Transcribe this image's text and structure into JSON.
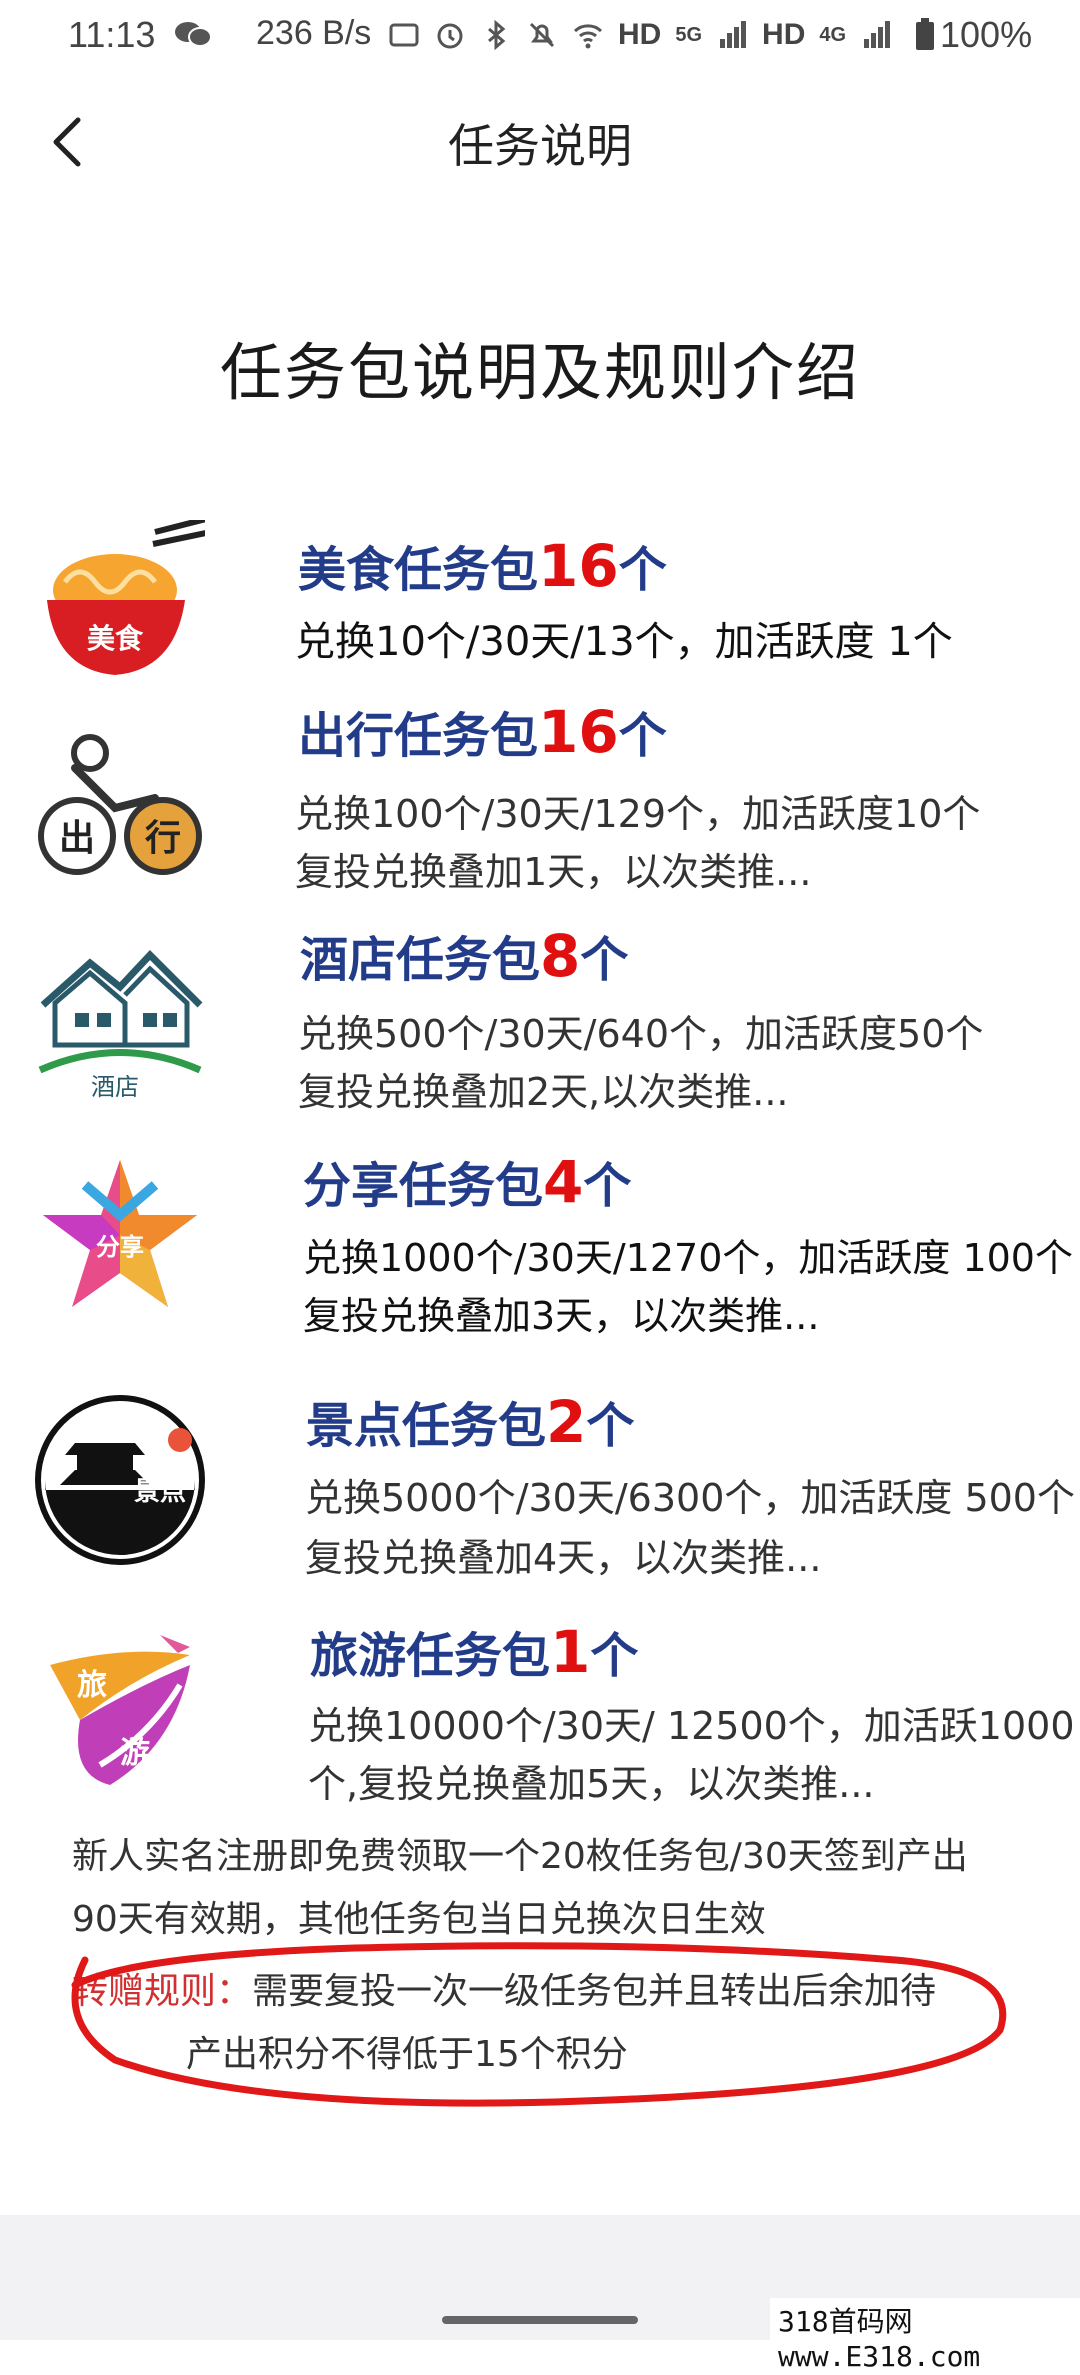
{
  "status_bar": {
    "time": "11:13",
    "net_speed": "236 B/s",
    "hd1": "HD",
    "net1": "5G",
    "hd2": "HD",
    "net2": "4G",
    "battery": "100%"
  },
  "header": {
    "title": "任务说明"
  },
  "main": {
    "heading": "任务包说明及规则介绍",
    "packages": [
      {
        "name": "美食任务包",
        "count": "16",
        "unit": "个",
        "icon_label": "美食",
        "desc": [
          "兑换10个/30天/13个，加活跃度 1个"
        ]
      },
      {
        "name": "出行任务包",
        "count": "16",
        "unit": "个",
        "icon_label": [
          "出",
          "行"
        ],
        "desc": [
          "兑换100个/30天/129个，加活跃度10个",
          "复投兑换叠加1天，以次类推..."
        ]
      },
      {
        "name": "酒店任务包",
        "count": "8",
        "unit": "个",
        "icon_label": "酒店",
        "desc": [
          "兑换500个/30天/640个，加活跃度50个",
          "复投兑换叠加2天,以次类推..."
        ]
      },
      {
        "name": "分享任务包",
        "count": "4",
        "unit": "个",
        "icon_label": "分享",
        "desc": [
          "兑换1000个/30天/1270个，加活跃度 100个",
          "复投兑换叠加3天，以次类推..."
        ]
      },
      {
        "name": "景点任务包",
        "count": "2",
        "unit": "个",
        "icon_label": "景点",
        "desc": [
          "兑换5000个/30天/6300个，加活跃度 500个",
          "复投兑换叠加4天，以次类推..."
        ]
      },
      {
        "name": "旅游任务包",
        "count": "1",
        "unit": "个",
        "icon_label": [
          "旅",
          "游"
        ],
        "desc": [
          "兑换10000个/30天/ 12500个，加活跃1000",
          "个,复投兑换叠加5天，以次类推..."
        ]
      }
    ],
    "note_lines": [
      "新人实名注册即免费领取一个20枚任务包/30天签到产出",
      "90天有效期，其他任务包当日兑换次日生效"
    ],
    "rule_label": "转赠规则：",
    "rule_text_1": "需要复投一次一级任务包并且转出后余加待",
    "rule_text_2": "产出积分不得低于15个积分"
  },
  "watermark": "318首码网  www.E318.com",
  "colors": {
    "title_blue": "#233c8a",
    "count_red": "#e01010",
    "rule_red": "#d23030",
    "annotation_red": "#e01818"
  }
}
